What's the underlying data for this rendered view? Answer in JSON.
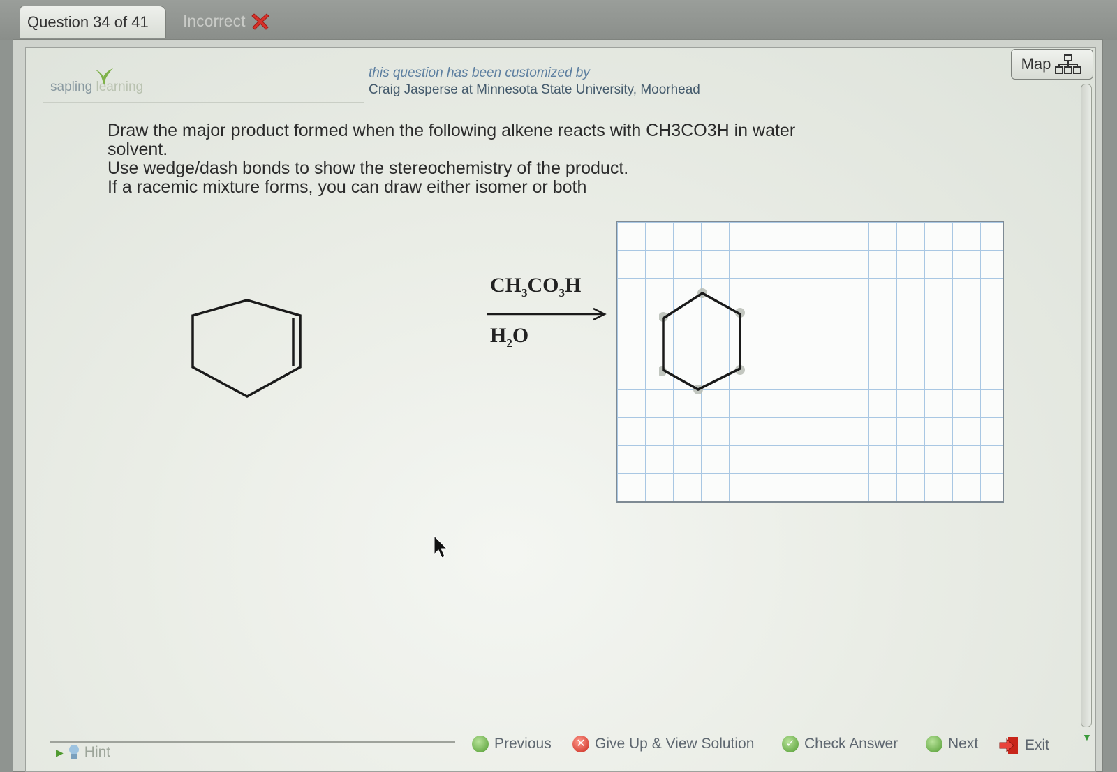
{
  "header": {
    "question_counter": "Question 34 of 41",
    "status_label": "Incorrect",
    "status_icon": "red-x-icon",
    "map_label": "Map"
  },
  "logo": {
    "part1": "sapling",
    "part2": "learning"
  },
  "customized": {
    "line1": "this question has been customized by",
    "line2": "Craig Jasperse at Minnesota State University, Moorhead"
  },
  "question": {
    "line1": "Draw the major product formed when the following alkene reacts with CH3CO3H in water",
    "line2": "solvent.",
    "line3": "Use wedge/dash bonds to show the stereochemistry of the product.",
    "line4": "If a racemic mixture forms, you can draw either isomer or both"
  },
  "reaction": {
    "reagent_top": {
      "a": "CH",
      "s1": "3",
      "b": "CO",
      "s2": "3",
      "c": "H"
    },
    "reagent_bottom": {
      "a": "H",
      "s1": "2",
      "b": "O"
    }
  },
  "footer": {
    "hint": "Hint",
    "previous": "Previous",
    "give_up": "Give Up & View Solution",
    "check": "Check Answer",
    "next": "Next",
    "exit": "Exit"
  },
  "colors": {
    "grid_line": "#a9c7e3",
    "accent_green": "#4f9a2f",
    "incorrect_red": "#d8312a"
  }
}
